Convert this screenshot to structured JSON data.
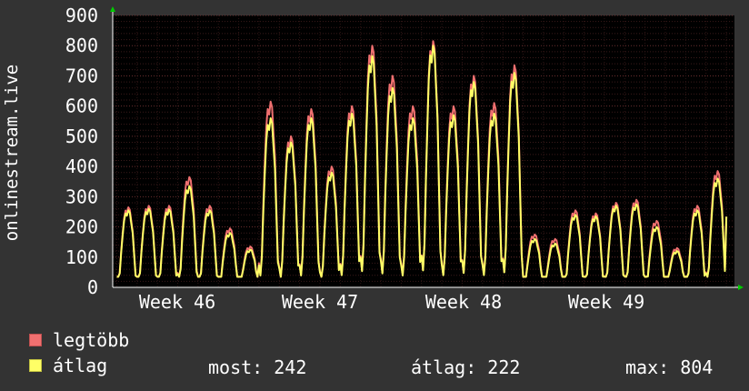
{
  "chart_data": {
    "type": "line",
    "ylabel": "onlinestream.live",
    "ylim": [
      0,
      900
    ],
    "yticks": [
      "0",
      "100",
      "200",
      "300",
      "400",
      "500",
      "600",
      "700",
      "800",
      "900"
    ],
    "x_labels": [
      "Week 46",
      "Week 47",
      "Week 48",
      "Week 49"
    ],
    "grid": true,
    "colors": {
      "background": "#333333",
      "canvas": "#000000",
      "grid": "#6a2f2f",
      "max_line": "#f07070",
      "avg_line": "#ffff66"
    },
    "days": [
      {
        "legtobb": 265,
        "atlag": 255
      },
      {
        "legtobb": 270,
        "atlag": 260
      },
      {
        "legtobb": 270,
        "atlag": 258
      },
      {
        "legtobb": 365,
        "atlag": 335
      },
      {
        "legtobb": 270,
        "atlag": 255
      },
      {
        "legtobb": 195,
        "atlag": 180
      },
      {
        "legtobb": 135,
        "atlag": 125
      },
      {
        "legtobb": 615,
        "atlag": 560
      },
      {
        "legtobb": 500,
        "atlag": 480
      },
      {
        "legtobb": 590,
        "atlag": 560
      },
      {
        "legtobb": 400,
        "atlag": 380
      },
      {
        "legtobb": 600,
        "atlag": 575
      },
      {
        "legtobb": 800,
        "atlag": 765
      },
      {
        "legtobb": 700,
        "atlag": 660
      },
      {
        "legtobb": 600,
        "atlag": 560
      },
      {
        "legtobb": 815,
        "atlag": 800
      },
      {
        "legtobb": 600,
        "atlag": 570
      },
      {
        "legtobb": 700,
        "atlag": 680
      },
      {
        "legtobb": 610,
        "atlag": 575
      },
      {
        "legtobb": 735,
        "atlag": 710
      },
      {
        "legtobb": 175,
        "atlag": 160
      },
      {
        "legtobb": 160,
        "atlag": 145
      },
      {
        "legtobb": 255,
        "atlag": 240
      },
      {
        "legtobb": 245,
        "atlag": 235
      },
      {
        "legtobb": 280,
        "atlag": 270
      },
      {
        "legtobb": 290,
        "atlag": 275
      },
      {
        "legtobb": 220,
        "atlag": 200
      },
      {
        "legtobb": 130,
        "atlag": 120
      },
      {
        "legtobb": 270,
        "atlag": 255
      },
      {
        "legtobb": 385,
        "atlag": 360
      }
    ],
    "series": [
      {
        "name": "legtöbb",
        "color": "#f07070"
      },
      {
        "name": "átlag",
        "color": "#ffff66"
      }
    ]
  },
  "legend": {
    "max_label": "legtöbb",
    "avg_label": "átlag",
    "most": "most: 242",
    "atlag": "átlag: 222",
    "max": "max: 804"
  }
}
